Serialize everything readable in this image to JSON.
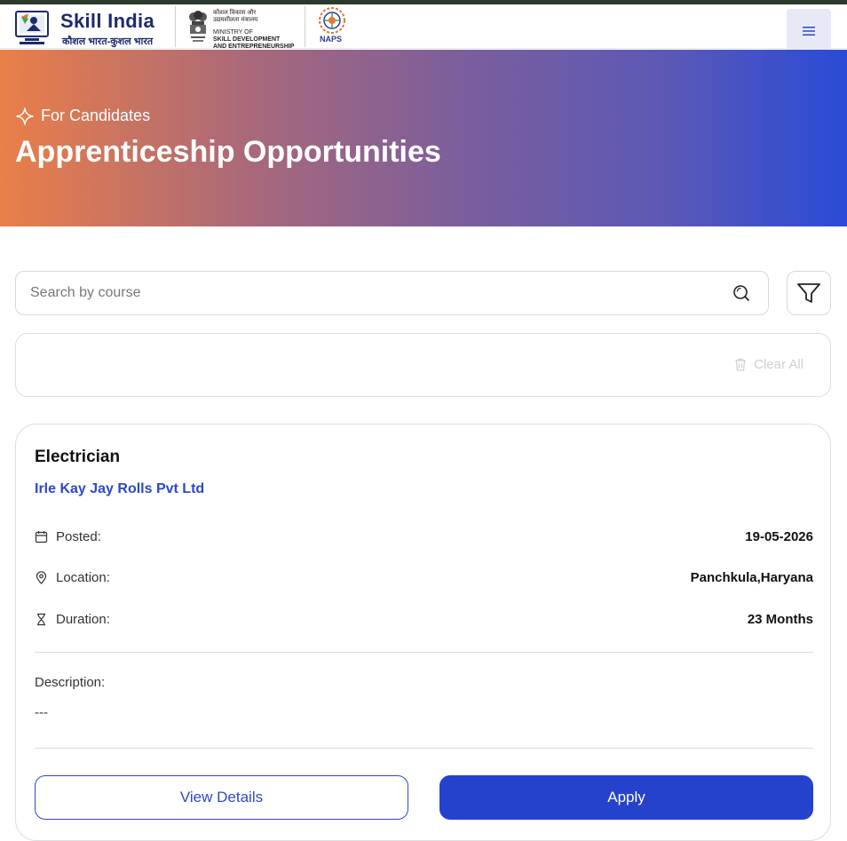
{
  "header": {
    "brand_title": "Skill India",
    "brand_tagline": "कौशल भारत-कुशल भारत",
    "ministry_hindi": "कौशल विकास और\nउद्यमशीलता मंत्रालय",
    "ministry_line1": "MINISTRY OF",
    "ministry_line2": "SKILL DEVELOPMENT",
    "ministry_line3": "AND ENTREPRENEURSHIP",
    "naps_label": "NAPS",
    "menu_icon": "hamburger-menu-icon"
  },
  "hero": {
    "eyebrow": "For Candidates",
    "title": "Apprenticeship Opportunities"
  },
  "search": {
    "placeholder": "Search by course",
    "value": ""
  },
  "filters": {
    "clear_all_label": "Clear All"
  },
  "job_card": {
    "title": "Electrician",
    "company": "Irle Kay Jay Rolls Pvt Ltd",
    "posted_label": "Posted:",
    "posted_value": "19-05-2026",
    "location_label": "Location:",
    "location_value": "Panchkula,Haryana",
    "duration_label": "Duration:",
    "duration_value": "23 Months",
    "description_label": "Description:",
    "description_value": "---",
    "view_details_label": "View Details",
    "apply_label": "Apply"
  },
  "colors": {
    "primary": "#2442cc",
    "link": "#2d48c8",
    "hero_start": "#ea7f48",
    "hero_end": "#2a4bd6",
    "brand_navy": "#1d2a6b"
  }
}
